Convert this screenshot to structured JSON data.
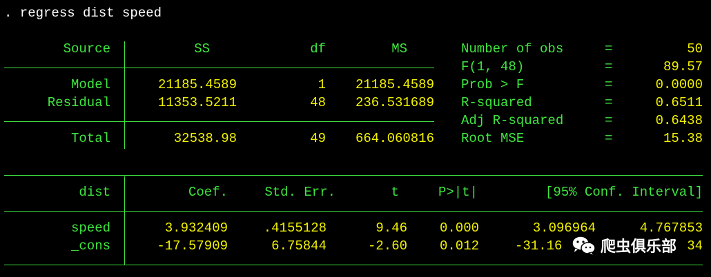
{
  "command": ". regress dist speed",
  "anova": {
    "headers": {
      "source": "Source",
      "ss": "SS",
      "df": "df",
      "ms": "MS"
    },
    "rows": [
      {
        "source": "Model",
        "ss": "21185.4589",
        "df": "1",
        "ms": "21185.4589"
      },
      {
        "source": "Residual",
        "ss": "11353.5211",
        "df": "48",
        "ms": "236.531689"
      }
    ],
    "total": {
      "source": "Total",
      "ss": "32538.98",
      "df": "49",
      "ms": "664.060816"
    }
  },
  "stats": [
    {
      "label": "Number of obs",
      "eq": "=",
      "value": "50"
    },
    {
      "label": "F(1, 48)",
      "eq": "=",
      "value": "89.57"
    },
    {
      "label": "Prob > F",
      "eq": "=",
      "value": "0.0000"
    },
    {
      "label": "R-squared",
      "eq": "=",
      "value": "0.6511"
    },
    {
      "label": "Adj R-squared",
      "eq": "=",
      "value": "0.6438"
    },
    {
      "label": "Root MSE",
      "eq": "=",
      "value": "15.38"
    }
  ],
  "coef_table": {
    "headers": {
      "var": "dist",
      "coef": "Coef.",
      "se": "Std. Err.",
      "t": "t",
      "p": "P>|t|",
      "ci": "[95% Conf. Interval]"
    },
    "rows": [
      {
        "var": "speed",
        "coef": "3.932409",
        "se": ".4155128",
        "t": "9.46",
        "p": "0.000",
        "lo": "3.096964",
        "hi": "4.767853"
      },
      {
        "var": "_cons",
        "coef": "-17.57909",
        "se": "6.75844",
        "t": "-2.60",
        "p": "0.012",
        "lo": "-31.16",
        "hi": "34"
      }
    ]
  },
  "watermark": {
    "text": "爬虫俱乐部",
    "icon": "wechat-icon"
  },
  "colors": {
    "background": "#000000",
    "command": "#ffffff",
    "label": "#3fe63f",
    "value": "#f2f200"
  }
}
